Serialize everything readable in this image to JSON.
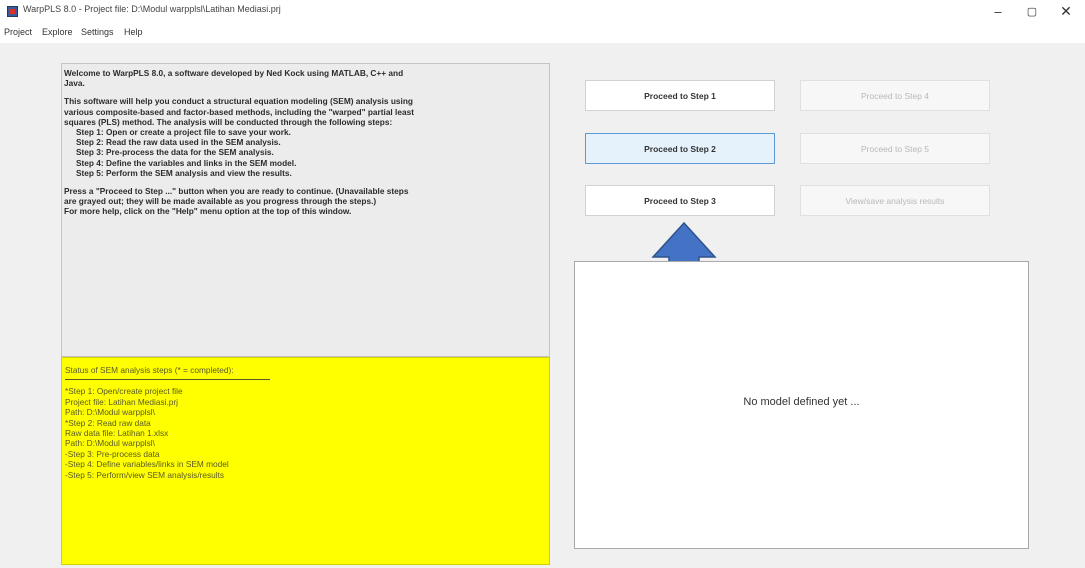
{
  "window": {
    "title": "WarpPLS 8.0 - Project file: D:\\Modul warpplsl\\Latihan Mediasi.prj",
    "minimize_glyph": "–",
    "maximize_glyph": "▢",
    "close_glyph": "✕"
  },
  "menu": [
    "Project",
    "Explore",
    "Settings",
    "Help"
  ],
  "welcome": {
    "paragraphs": [
      [
        " Welcome to WarpPLS 8.0, a software developed by Ned Kock using MATLAB, C++ and",
        "Java."
      ],
      [
        " This software will help you conduct a structural equation modeling (SEM) analysis using",
        "various composite-based and factor-based methods, including the \"warped\" partial least",
        "squares (PLS) method. The analysis will be conducted through the following steps:"
      ],
      [
        "Step 1: Open or create a project file to save your work.",
        "Step 2: Read the raw data used in the SEM analysis.",
        "Step 3: Pre-process the data for the SEM analysis.",
        "Step 4: Define the variables and links in the SEM model.",
        "Step 5: Perform the SEM analysis and view the results."
      ],
      [
        " Press a \"Proceed to Step ...\" button when you are ready to continue. (Unavailable steps",
        "are grayed out; they will be made available as you progress through the steps.)",
        " For more help, click on the \"Help\" menu option at the top of this window."
      ]
    ]
  },
  "status": {
    "header": "Status of SEM analysis steps (* = completed):",
    "lines": [
      "*Step 1: Open/create project file",
      " Project file: Latihan Mediasi.prj",
      " Path: D:\\Modul warpplsl\\",
      "*Step 2: Read raw data",
      " Raw data file: Latihan 1.xlsx",
      " Path: D:\\Modul warpplsl\\",
      "-Step 3: Pre-process data",
      "-Step 4: Define variables/links in SEM model",
      "-Step 5: Perform/view SEM analysis/results"
    ]
  },
  "buttons": {
    "step1": "Proceed to Step 1",
    "step2": "Proceed to Step 2",
    "step3": "Proceed to Step 3",
    "step4": "Proceed to Step 4",
    "step5": "Proceed to Step 5",
    "view_results": "View/save analysis results"
  },
  "model_panel": {
    "message": "No model defined yet ..."
  },
  "colors": {
    "status_bg": "#ffff00",
    "active_button_bg": "#e5f1fb",
    "arrow": "#4472c4"
  }
}
